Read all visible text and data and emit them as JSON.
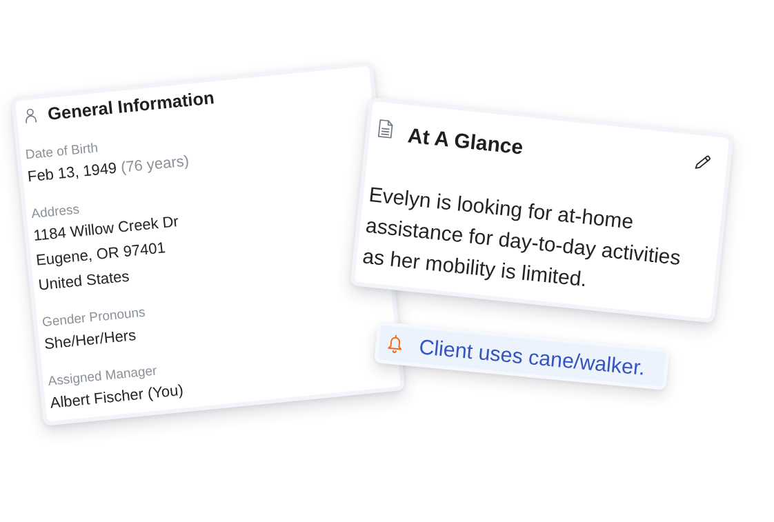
{
  "general_information": {
    "title": "General Information",
    "fields": [
      {
        "label": "Date of Birth",
        "lines": [
          "Feb 13, 1949"
        ],
        "note": "(76 years)"
      },
      {
        "label": "Address",
        "lines": [
          "1184 Willow Creek Dr",
          "Eugene, OR 97401",
          "United States"
        ]
      },
      {
        "label": "Gender Pronouns",
        "lines": [
          "She/Her/Hers"
        ]
      },
      {
        "label": "Assigned Manager",
        "lines": [
          "Albert Fischer (You)"
        ]
      }
    ]
  },
  "at_a_glance": {
    "title": "At A Glance",
    "text": "Evelyn is looking for at-home assistance for day-to-day activities as her mobility is limited."
  },
  "alert": {
    "text": "Client uses cane/walker."
  }
}
